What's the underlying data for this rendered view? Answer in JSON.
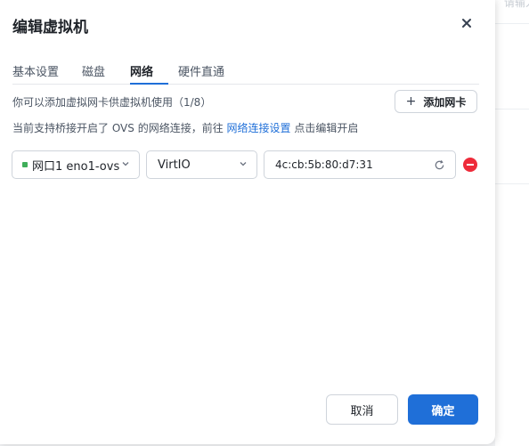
{
  "dialog": {
    "title": "编辑虚拟机"
  },
  "tabs": [
    {
      "label": "基本设置",
      "active": false
    },
    {
      "label": "磁盘",
      "active": false
    },
    {
      "label": "网络",
      "active": true
    },
    {
      "label": "硬件直通",
      "active": false
    }
  ],
  "network": {
    "info": "你可以添加虚拟网卡供虚拟机使用（1/8）",
    "ovs_hint_prefix": "当前支持桥接开启了 OVS 的网络连接，前往",
    "ovs_hint_link": "网络连接设置",
    "ovs_hint_suffix": "点击编辑开启",
    "add_button": "添加网卡",
    "nic": {
      "interface": "网口1 eno1-ovs",
      "model": "VirtIO",
      "mac": "4c:cb:5b:80:d7:31"
    }
  },
  "footer": {
    "cancel": "取消",
    "confirm": "确定"
  },
  "background": {
    "hint_text": "请输入搜"
  },
  "colors": {
    "accent": "#1f6fd8",
    "remove": "#ee2b3a",
    "status_dot": "#3fae5a"
  },
  "icons": [
    "close-icon",
    "plus-icon",
    "chevron-down-icon",
    "refresh-icon",
    "remove-icon"
  ]
}
